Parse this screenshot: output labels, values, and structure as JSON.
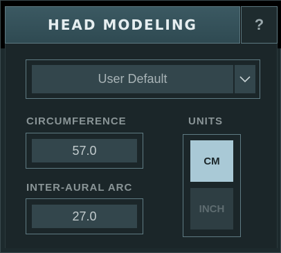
{
  "header": {
    "title": "HEAD MODELING",
    "help_label": "?"
  },
  "preset": {
    "selected": "User Default"
  },
  "circumference": {
    "label": "CIRCUMFERENCE",
    "value": "57.0"
  },
  "inter_aural_arc": {
    "label": "INTER-AURAL ARC",
    "value": "27.0"
  },
  "units": {
    "label": "UNITS",
    "options": [
      "CM",
      "INCH"
    ],
    "selected": "CM"
  },
  "colors": {
    "panel_bg": "#1b2629",
    "field_bg": "#33464c",
    "frame_border": "#607c84",
    "active_unit": "#a9c9d6",
    "inactive_unit": "#2e3e43"
  },
  "icons": {
    "dropdown": "chevron-down-icon"
  }
}
